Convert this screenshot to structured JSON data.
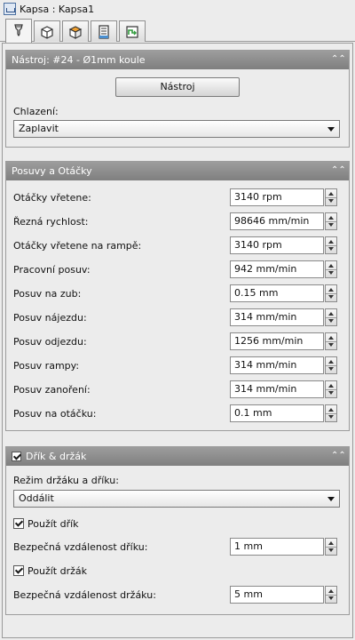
{
  "window": {
    "title": "Kapsa : Kapsa1",
    "icon": "pocket-app-icon"
  },
  "tabs": [
    {
      "name": "tool-tab",
      "icon": "tool-holder-icon",
      "active": true
    },
    {
      "name": "geometry-tab",
      "icon": "cube-outline-icon",
      "active": false
    },
    {
      "name": "heights-tab",
      "icon": "cube-orange-icon",
      "active": false
    },
    {
      "name": "passes-tab",
      "icon": "passes-icon",
      "active": false
    },
    {
      "name": "linking-tab",
      "icon": "linking-icon",
      "active": false
    }
  ],
  "tool_section": {
    "title": "Nástroj: #24 - Ø1mm koule",
    "tool_button": "Nástroj",
    "coolant_label": "Chlazení:",
    "coolant_value": "Zaplavit"
  },
  "feeds_section": {
    "title": "Posuvy a Otáčky",
    "rows": [
      {
        "label": "Otáčky vřetene:",
        "value": "3140 rpm"
      },
      {
        "label": "Řezná rychlost:",
        "value": "98646 mm/min"
      },
      {
        "label": "Otáčky vřetene na rampě:",
        "value": "3140 rpm"
      },
      {
        "label": "Pracovní posuv:",
        "value": "942 mm/min"
      },
      {
        "label": "Posuv na zub:",
        "value": "0.15 mm"
      },
      {
        "label": "Posuv nájezdu:",
        "value": "314 mm/min"
      },
      {
        "label": "Posuv odjezdu:",
        "value": "1256 mm/min"
      },
      {
        "label": "Posuv rampy:",
        "value": "314 mm/min"
      },
      {
        "label": "Posuv zanoření:",
        "value": "314 mm/min"
      },
      {
        "label": "Posuv na otáčku:",
        "value": "0.1 mm"
      }
    ]
  },
  "shank_section": {
    "title": "Dřík & držák",
    "enabled": true,
    "mode_label": "Režim držáku a dříku:",
    "mode_value": "Oddálit",
    "use_shank_label": "Použít dřík",
    "use_shank_checked": true,
    "shank_clearance_label": "Bezpečná vzdálenost dříku:",
    "shank_clearance_value": "1 mm",
    "use_holder_label": "Použít držák",
    "use_holder_checked": true,
    "holder_clearance_label": "Bezpečná vzdálenost držáku:",
    "holder_clearance_value": "5 mm"
  },
  "colors": {
    "header_bg": "#8d8d8d",
    "panel_bg": "#ececec",
    "accent": "#f0a030"
  }
}
